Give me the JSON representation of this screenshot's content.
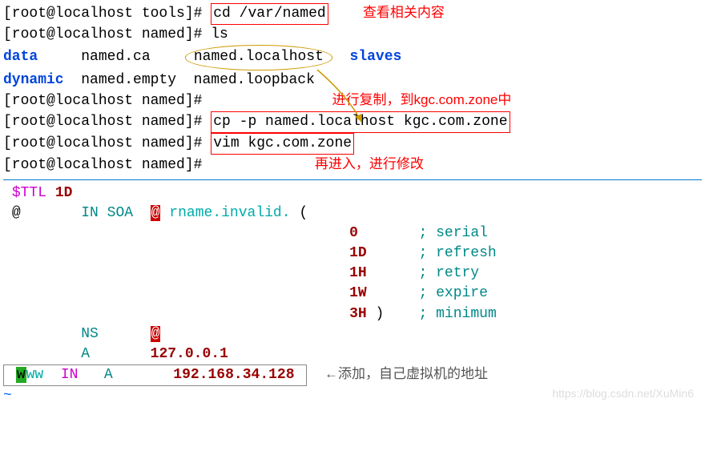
{
  "terminal": {
    "prompt_tools": "[root@localhost tools]# ",
    "prompt_named": "[root@localhost named]# ",
    "cmd_cd": "cd /var/named",
    "cmd_ls": "ls",
    "ls_output": {
      "data": "data",
      "named_ca": "named.ca",
      "named_localhost": "named.localhost",
      "slaves": "slaves",
      "dynamic": "dynamic",
      "named_empty": "named.empty",
      "named_loopback": "named.loopback"
    },
    "cmd_cp": "cp -p named.localhost kgc.com.zone",
    "cmd_vim": "vim kgc.com.zone"
  },
  "annotations": {
    "view_content": "查看相关内容",
    "copy_to": "进行复制，到kgc.com.zone中",
    "enter_modify": "再进入，进行修改",
    "add_vm_addr": "添加，自己虚拟机的地址"
  },
  "zonefile": {
    "ttl_key": "$TTL",
    "ttl_val": "1D",
    "at": "@",
    "in_soa": "IN SOA",
    "rname": "rname.invalid.",
    "paren_open": "(",
    "paren_close": ")",
    "records": {
      "serial_val": "0",
      "serial_lbl": "; serial",
      "refresh_val": "1D",
      "refresh_lbl": "; refresh",
      "retry_val": "1H",
      "retry_lbl": "; retry",
      "expire_val": "1W",
      "expire_lbl": "; expire",
      "minimum_val": "3H",
      "minimum_lbl": "; minimum"
    },
    "ns": "NS",
    "a": "A",
    "ip_local": "127.0.0.1",
    "www_w": "w",
    "www_rest": "ww",
    "in": "IN",
    "ip_vm": "192.168.34.128",
    "tilde": "~"
  },
  "watermark": "https://blog.csdn.net/XuMin6"
}
